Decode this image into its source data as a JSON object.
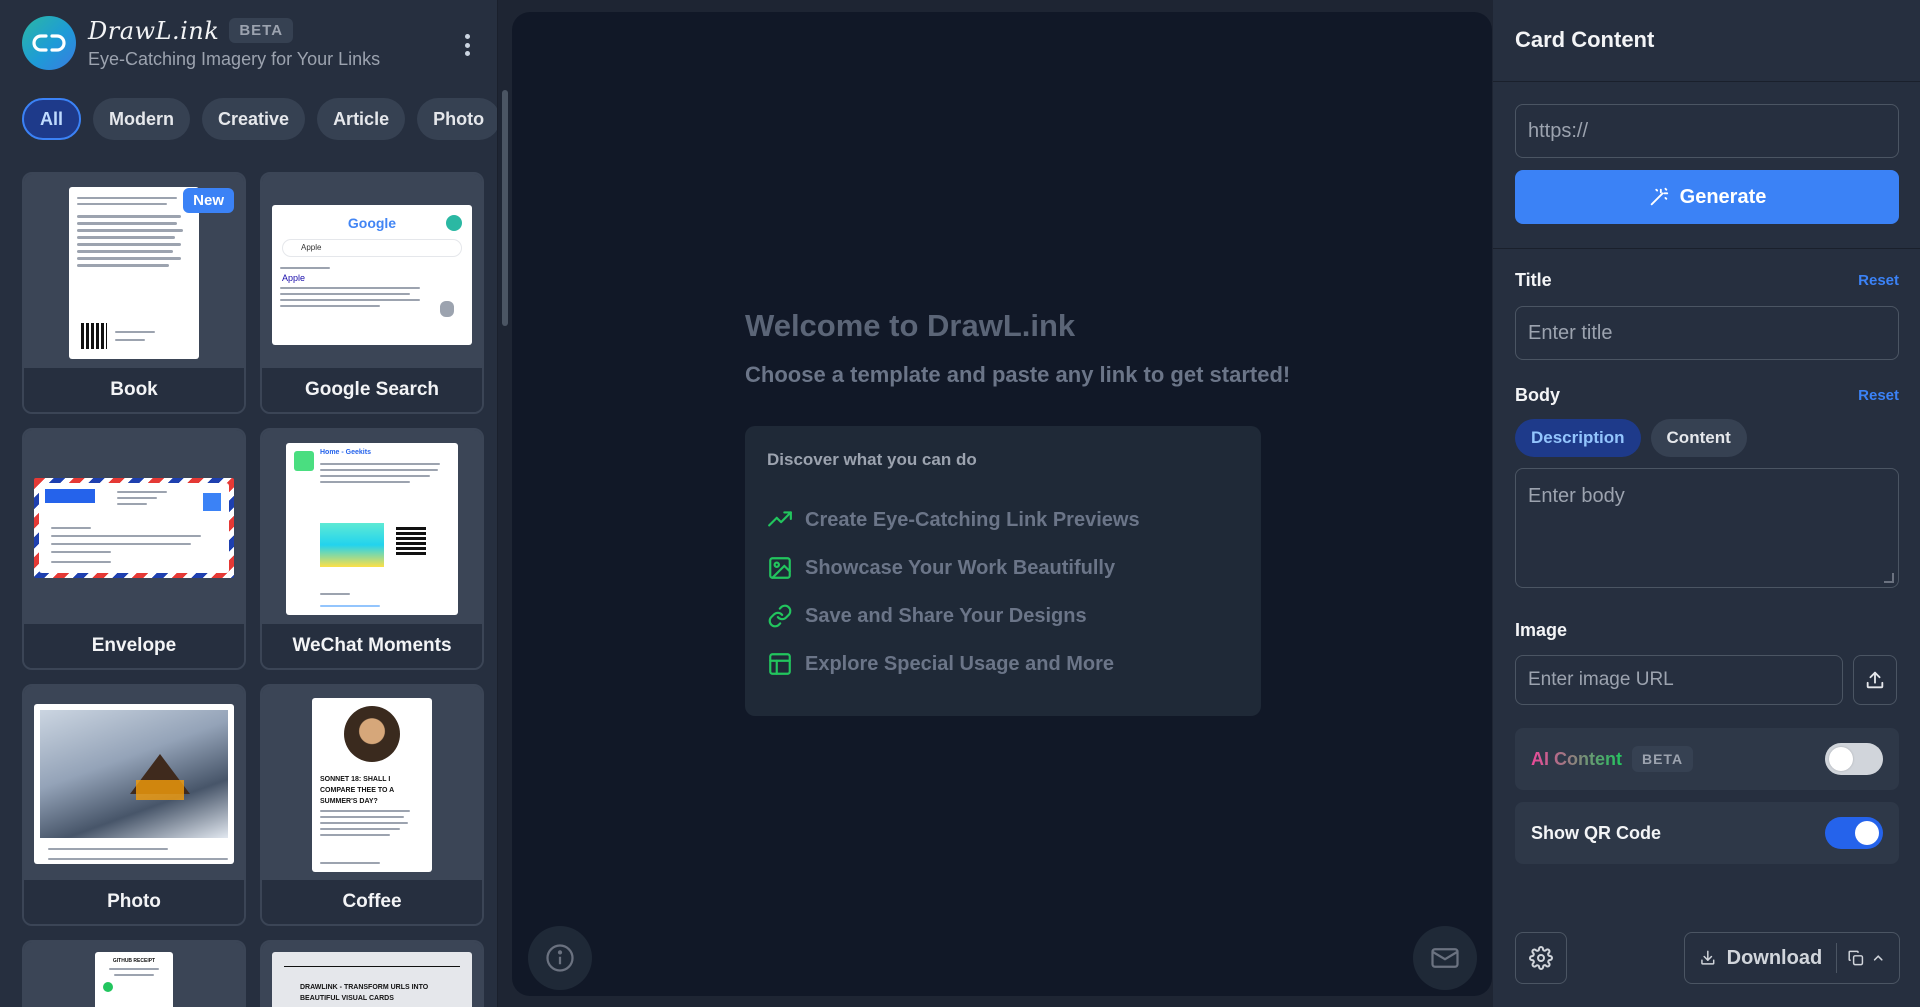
{
  "brand": {
    "name": "DrawL.ink",
    "badge": "BETA",
    "tagline": "Eye-Catching Imagery for Your Links"
  },
  "filters": [
    "All",
    "Modern",
    "Creative",
    "Article",
    "Photo"
  ],
  "active_filter": "All",
  "templates": [
    {
      "name": "Book",
      "badge": "New"
    },
    {
      "name": "Google Search"
    },
    {
      "name": "Envelope"
    },
    {
      "name": "WeChat Moments"
    },
    {
      "name": "Photo"
    },
    {
      "name": "Coffee"
    }
  ],
  "thumbnails": {
    "google_logo": "Google",
    "google_query": "Apple",
    "google_result_title": "Apple",
    "wechat_title": "Home - Geekits",
    "coffee_title": "SONNET 18: SHALL I COMPARE THEE TO A SUMMER'S DAY?",
    "receipt_title": "GITHUB RECEIPT",
    "drawlink_card_title": "DRAWLINK - TRANSFORM URLS INTO BEAUTIFUL VISUAL CARDS"
  },
  "center": {
    "welcome": "Welcome to DrawL.ink",
    "subtitle": "Choose a template and paste any link to get started!",
    "discover_title": "Discover what you can do",
    "features": [
      {
        "label": "Create Eye-Catching Link Previews",
        "icon": "trending-up-icon"
      },
      {
        "label": "Showcase Your Work Beautifully",
        "icon": "image-icon"
      },
      {
        "label": "Save and Share Your Designs",
        "icon": "link-icon"
      },
      {
        "label": "Explore Special Usage and More",
        "icon": "layout-icon"
      }
    ],
    "feature_color": "#22c55e"
  },
  "panel": {
    "title": "Card Content",
    "url_placeholder": "https://",
    "generate_label": "Generate",
    "title_label": "Title",
    "title_placeholder": "Enter title",
    "reset_label": "Reset",
    "body_label": "Body",
    "body_tabs": [
      "Description",
      "Content"
    ],
    "active_body_tab": "Description",
    "body_placeholder": "Enter body",
    "image_label": "Image",
    "image_placeholder": "Enter image URL",
    "ai_label": "AI Content",
    "ai_badge": "BETA",
    "ai_enabled": false,
    "qr_label": "Show QR Code",
    "qr_enabled": true,
    "download_label": "Download"
  },
  "colors": {
    "accent": "#3b82f6",
    "background": "#1e2533",
    "canvas": "#111827"
  }
}
